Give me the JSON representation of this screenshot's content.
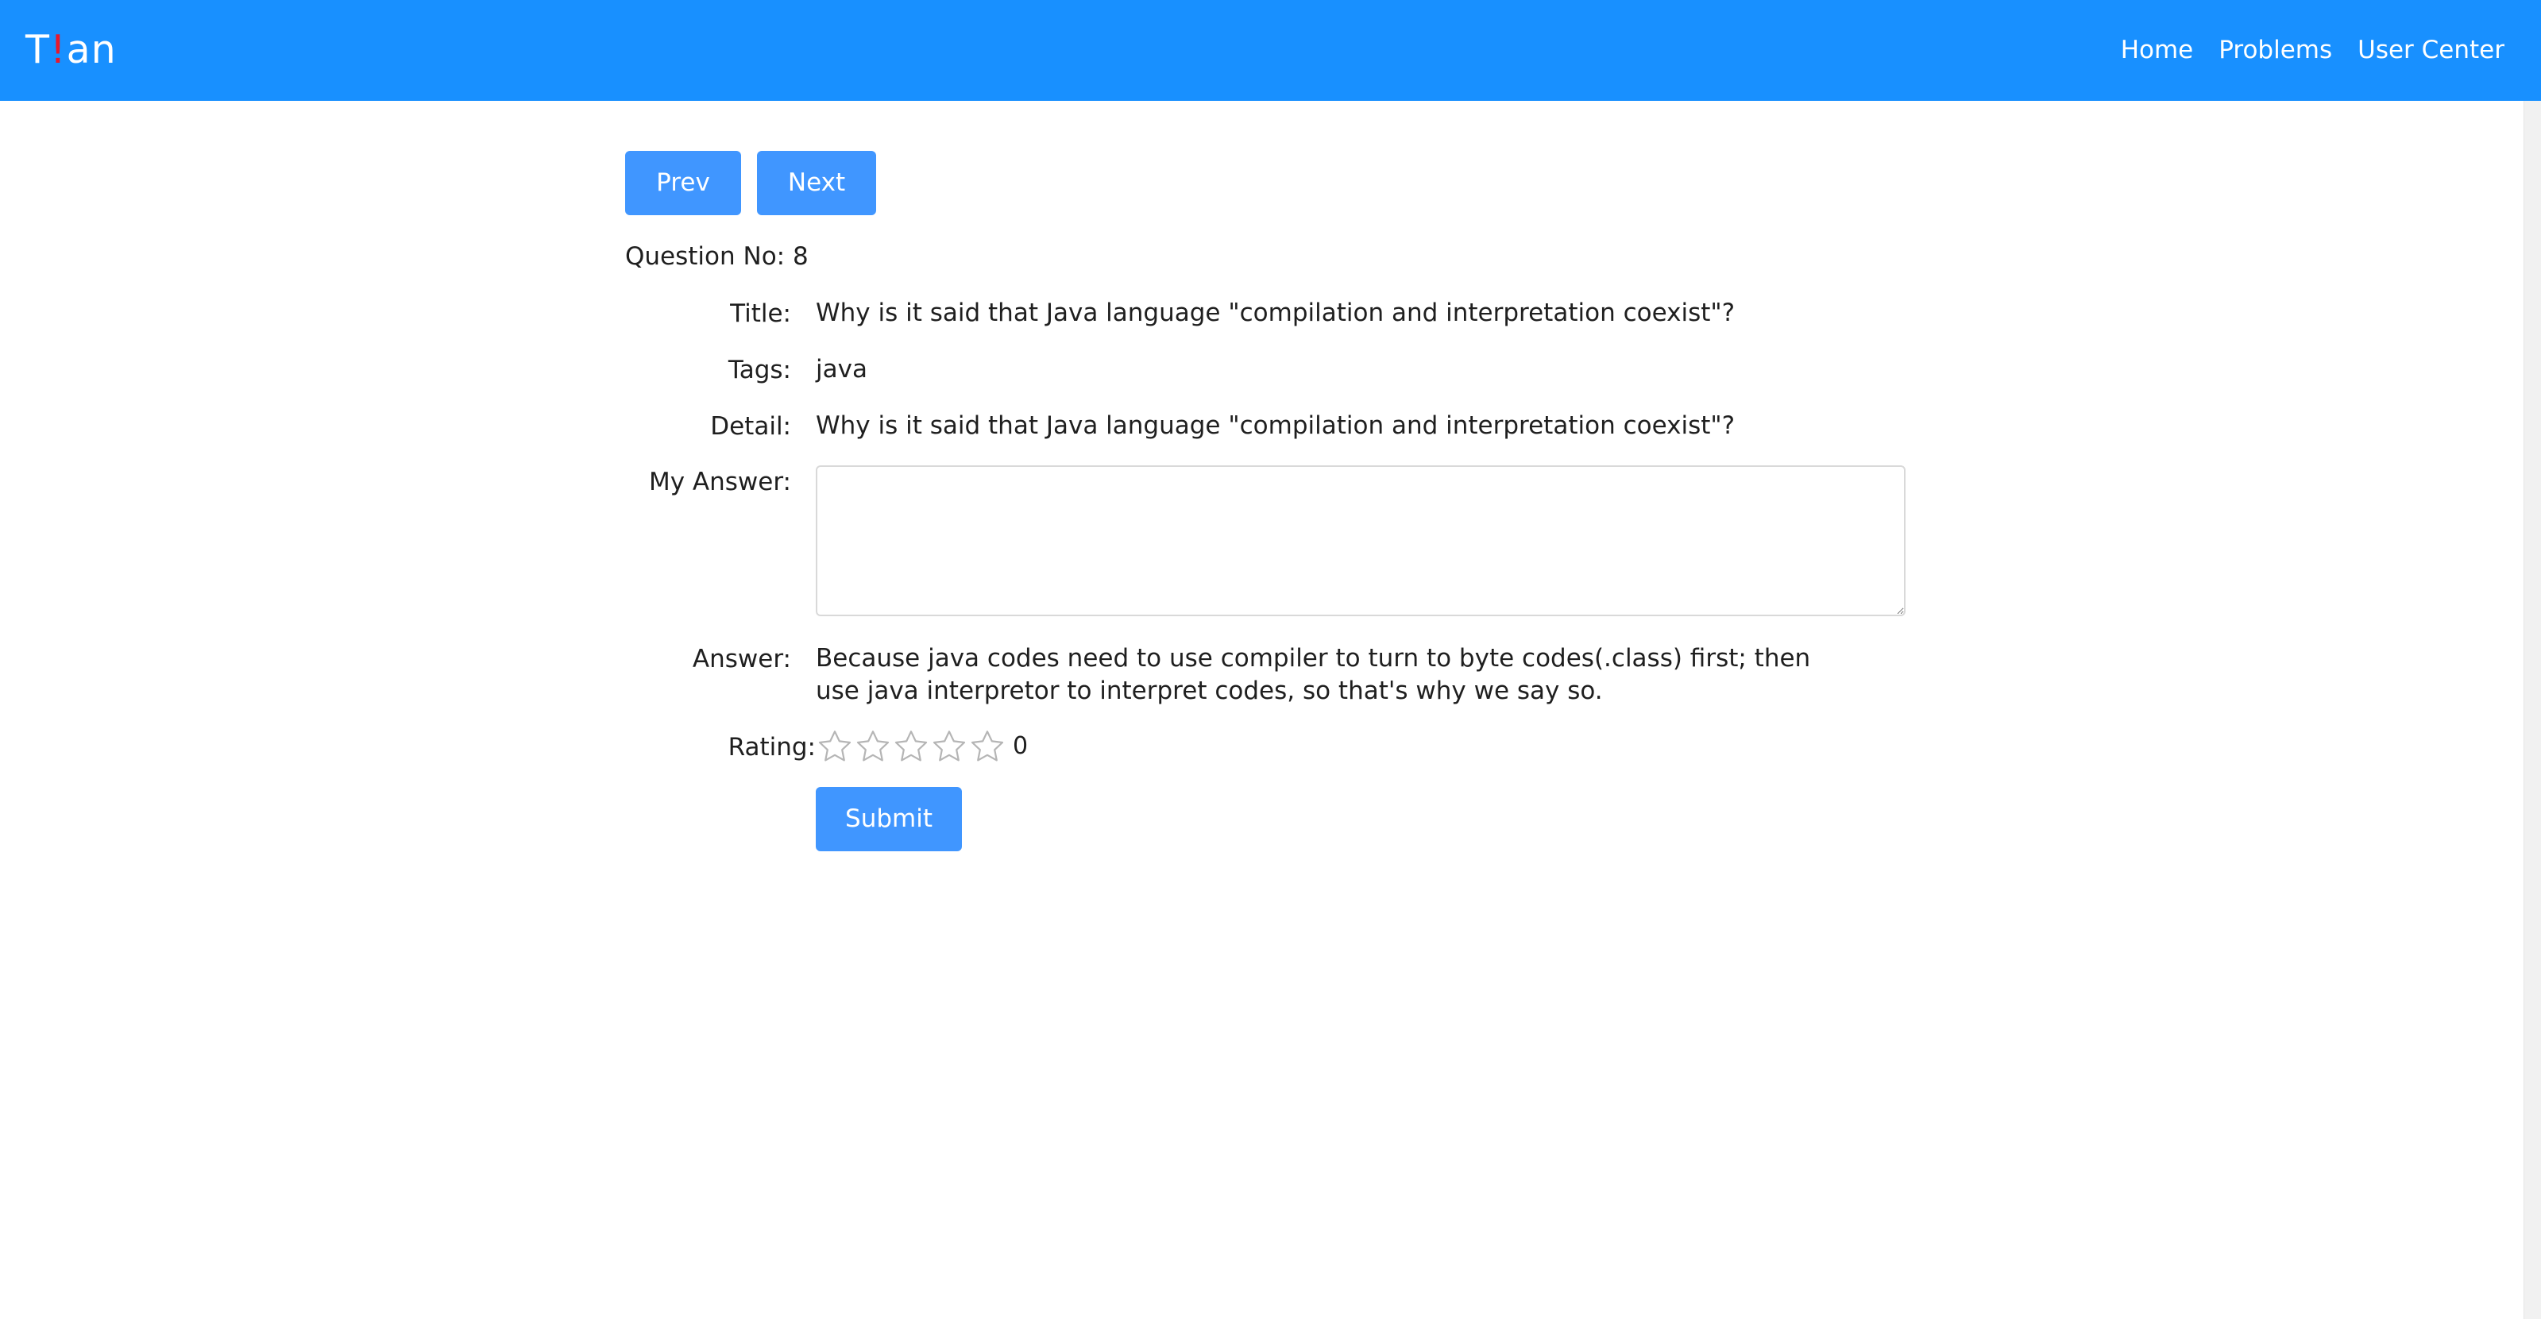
{
  "header": {
    "logo_t": "T",
    "logo_bang": "!",
    "logo_rest": "an",
    "nav": [
      "Home",
      "Problems",
      "User Center"
    ]
  },
  "buttons": {
    "prev": "Prev",
    "next": "Next",
    "submit": "Submit"
  },
  "question": {
    "number_text": "Question No: 8",
    "title_label": "Title:",
    "title": "Why is it said that Java language \"compilation and interpretation coexist\"?",
    "tags_label": "Tags:",
    "tags": "java",
    "detail_label": "Detail:",
    "detail": "Why is it said that Java language \"compilation and interpretation coexist\"?",
    "my_answer_label": "My Answer:",
    "my_answer_value": "",
    "answer_label": "Answer:",
    "answer": "Because java codes need to use compiler to turn to byte codes(.class) first; then use java interpretor to interpret codes, so that's why we say so.",
    "rating_label": "Rating:",
    "rating_value": 0,
    "rating_max": 5,
    "rating_count_text": "0"
  },
  "colors": {
    "header_bg": "#1890ff",
    "button_bg": "#4096ff",
    "logo_accent": "#e8172c"
  }
}
